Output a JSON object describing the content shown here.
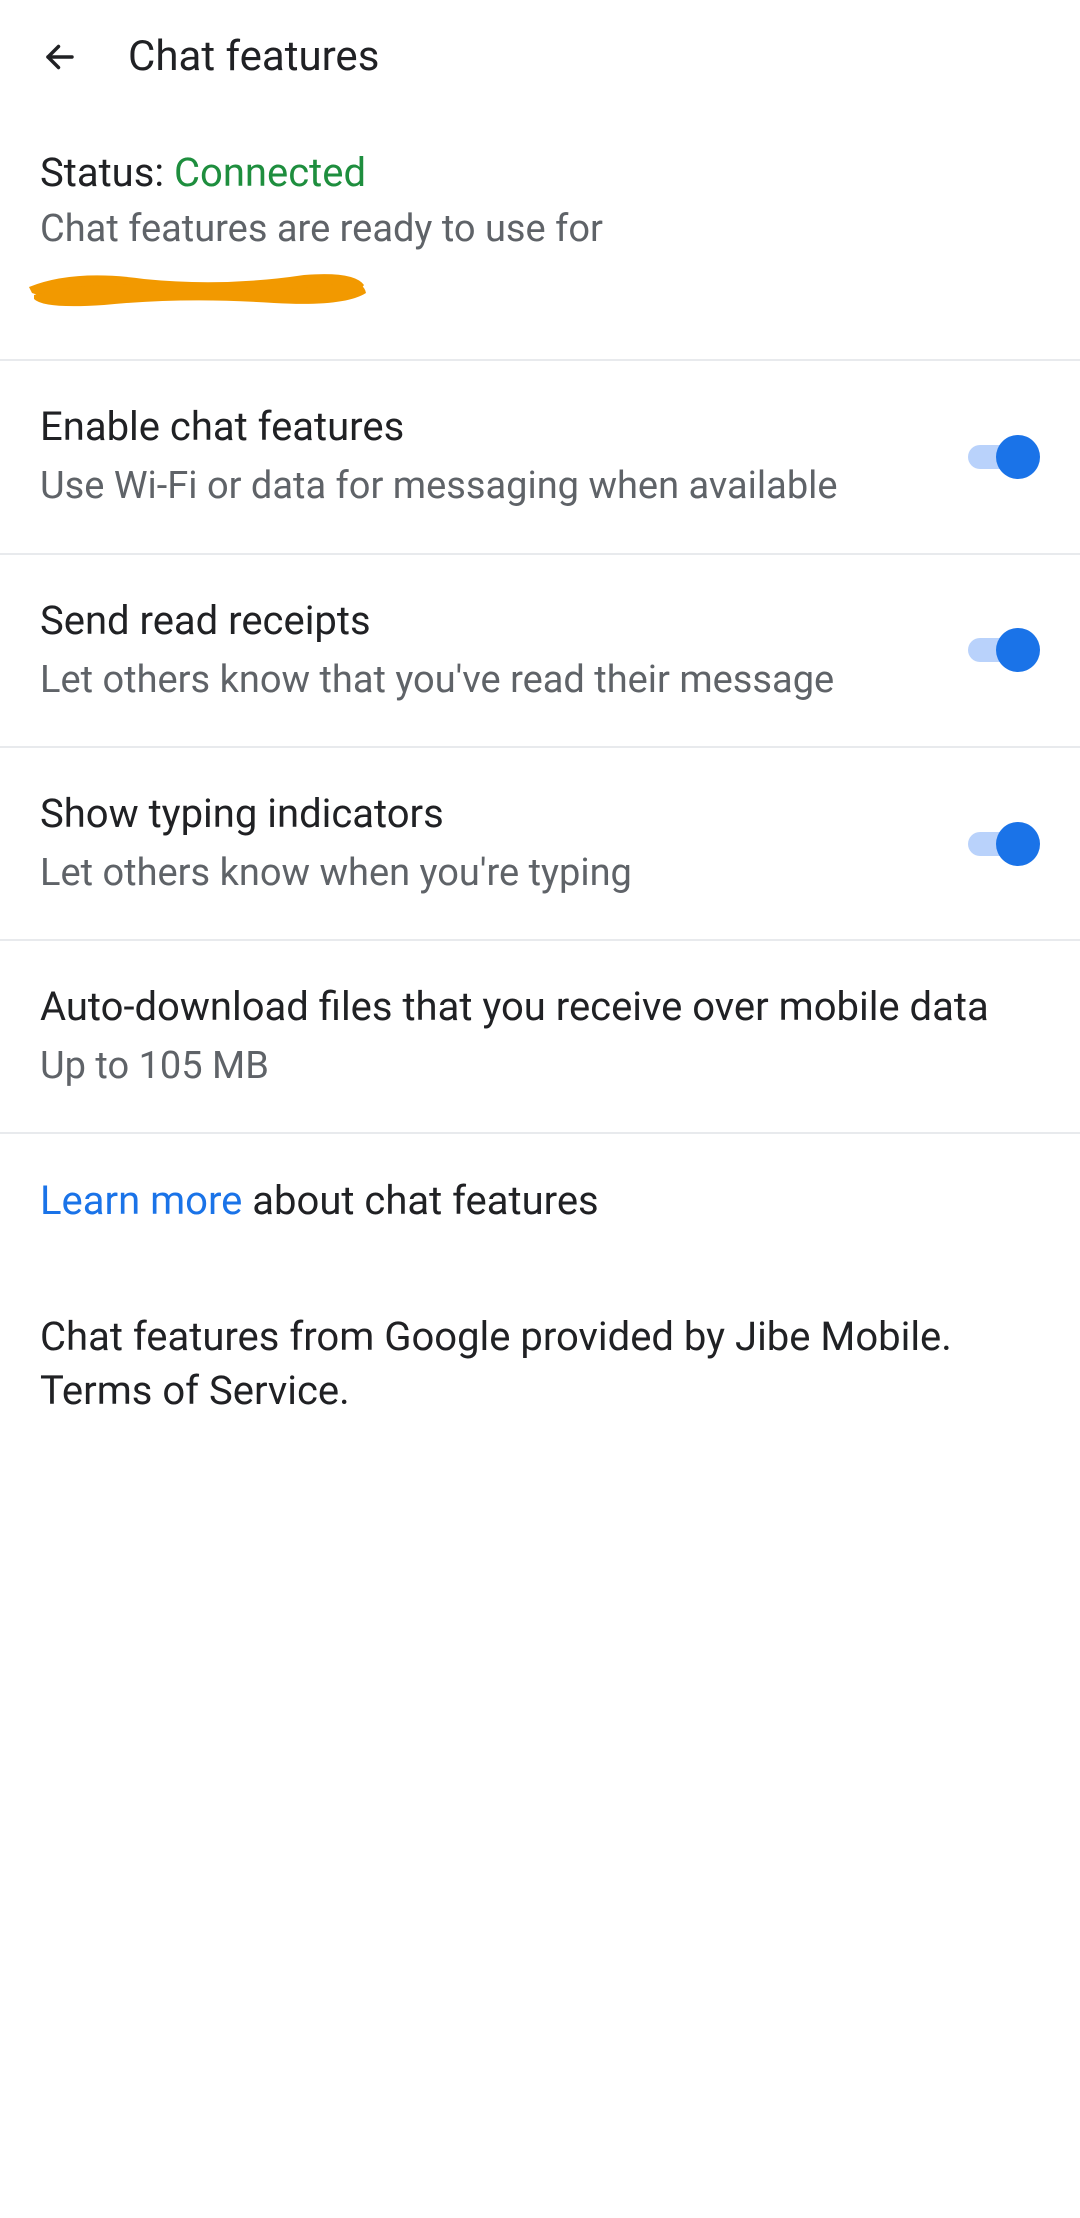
{
  "header": {
    "title": "Chat features"
  },
  "status": {
    "label": "Status: ",
    "value": "Connected",
    "subtitle": "Chat features are ready to use for"
  },
  "settings": [
    {
      "title": "Enable chat features",
      "desc": "Use Wi-Fi or data for messaging when available",
      "toggle": true
    },
    {
      "title": "Send read receipts",
      "desc": "Let others know that you've read their message",
      "toggle": true
    },
    {
      "title": "Show typing indicators",
      "desc": "Let others know when you're typing",
      "toggle": true
    },
    {
      "title": "Auto-download files that you receive over mobile data",
      "desc": "Up to 105 MB",
      "toggle": false
    }
  ],
  "learn": {
    "link": "Learn more",
    "rest": " about chat features"
  },
  "footer": {
    "text": "Chat features from Google provided by Jibe Mobile. Terms of Service."
  },
  "colors": {
    "primary": "#1a73e8",
    "success": "#1e8e3e",
    "text": "#202124",
    "text_secondary": "#5f6368"
  }
}
